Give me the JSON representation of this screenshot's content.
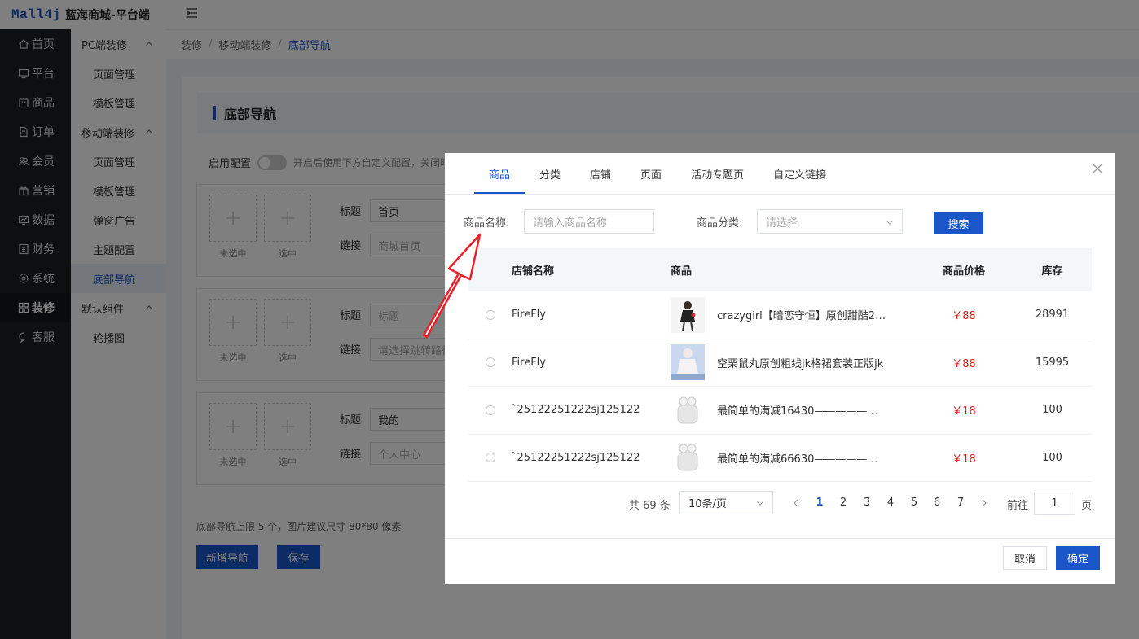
{
  "header": {
    "logo": "Mall4j",
    "title": "蓝海商城-平台端"
  },
  "sidebar": {
    "items": [
      {
        "label": "首页",
        "icon": "home-icon"
      },
      {
        "label": "平台",
        "icon": "monitor-icon"
      },
      {
        "label": "商品",
        "icon": "bag-icon"
      },
      {
        "label": "订单",
        "icon": "document-icon"
      },
      {
        "label": "会员",
        "icon": "users-icon"
      },
      {
        "label": "营销",
        "icon": "gift-icon"
      },
      {
        "label": "数据",
        "icon": "chart-icon"
      },
      {
        "label": "财务",
        "icon": "finance-icon"
      },
      {
        "label": "系统",
        "icon": "gear-icon"
      },
      {
        "label": "装修",
        "icon": "decor-icon",
        "active": true
      },
      {
        "label": "客服",
        "icon": "chat-icon"
      }
    ]
  },
  "subnav": {
    "groups": [
      {
        "title": "PC端装修",
        "items": [
          "页面管理",
          "模板管理"
        ]
      },
      {
        "title": "移动端装修",
        "items": [
          "页面管理",
          "模板管理",
          "弹窗广告",
          "主题配置",
          "底部导航"
        ]
      },
      {
        "title": "默认组件",
        "items": [
          "轮播图"
        ]
      }
    ],
    "active": "底部导航"
  },
  "breadcrumb": [
    "装修",
    "移动端装修",
    "底部导航"
  ],
  "page": {
    "title": "底部导航",
    "config_label": "启用配置",
    "config_hint": "开启后使用下方自定义配置，关闭时",
    "cards": [
      {
        "title_label": "标题",
        "title_value": "首页",
        "title_filled": true,
        "link_label": "链接",
        "link_value": "商城首页",
        "link_filled": true,
        "unselected": "未选中",
        "selected": "选中"
      },
      {
        "title_label": "标题",
        "title_value": "标题",
        "title_filled": false,
        "link_label": "链接",
        "link_value": "请选择跳转路径",
        "link_filled": false,
        "unselected": "未选中",
        "selected": "选中"
      },
      {
        "title_label": "标题",
        "title_value": "我的",
        "title_filled": true,
        "link_label": "链接",
        "link_value": "个人中心",
        "link_filled": true,
        "unselected": "未选中",
        "selected": "选中"
      }
    ],
    "limit_text": "底部导航上限 5 个，图片建议尺寸 80*80 像素",
    "add_label": "新增导航",
    "save_label": "保存"
  },
  "dialog": {
    "tabs": [
      "商品",
      "分类",
      "店铺",
      "页面",
      "活动专题页",
      "自定义链接"
    ],
    "active_tab": "商品",
    "search": {
      "name_label": "商品名称:",
      "name_placeholder": "请输入商品名称",
      "cat_label": "商品分类:",
      "cat_placeholder": "请选择",
      "button": "搜索"
    },
    "table": {
      "columns": [
        "店铺名称",
        "商品",
        "商品价格",
        "库存"
      ],
      "rows": [
        {
          "shop": "FireFly",
          "product": "crazygirl【暗恋守恒】原创甜酷2024",
          "price": "￥88",
          "stock": "28991",
          "thumb": "girl-photo"
        },
        {
          "shop": "FireFly",
          "product": "空栗鼠丸原创粗线jk格裙套装正版jk",
          "price": "￥88",
          "stock": "15995",
          "thumb": "dress-photo"
        },
        {
          "shop": "`25122251222sj125122",
          "product": "最简单的满减16430——————————",
          "price": "￥18",
          "stock": "100",
          "thumb": "earbuds-photo"
        },
        {
          "shop": "`25122251222sj125122",
          "product": "最简单的满减66630——————————",
          "price": "￥18",
          "stock": "100",
          "thumb": "earbuds-photo"
        }
      ]
    },
    "pager": {
      "total": "共 69 条",
      "page_size": "10条/页",
      "pages": [
        "1",
        "2",
        "3",
        "4",
        "5",
        "6",
        "7"
      ],
      "current": "1",
      "jump_prefix": "前往",
      "jump_value": "1",
      "jump_suffix": "页"
    },
    "cancel": "取消",
    "confirm": "确定"
  },
  "colors": {
    "primary": "#1a56c8",
    "price": "#e02020",
    "sidebar": "#1d1e23",
    "annotation": "#e8202a"
  }
}
